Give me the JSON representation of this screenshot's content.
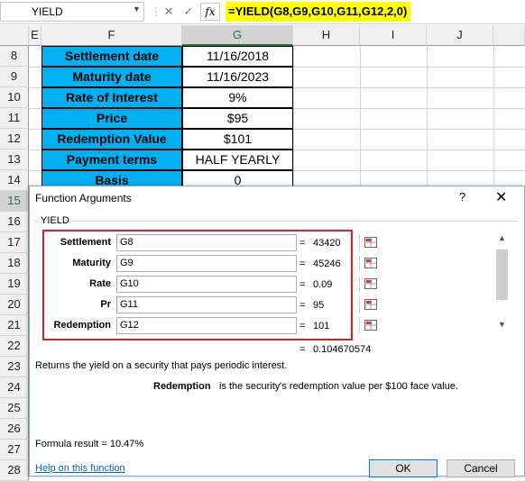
{
  "formula_bar": {
    "name_box": "YIELD",
    "cancel_symbol": "✕",
    "enter_symbol": "✓",
    "fx_label": "fx",
    "formula": "=YIELD(G8,G9,G10,G11,G12,2,0)"
  },
  "columns": [
    "E",
    "F",
    "G",
    "H",
    "I",
    "J"
  ],
  "rows": [
    "8",
    "9",
    "10",
    "11",
    "12",
    "13",
    "14",
    "15",
    "16",
    "17",
    "18",
    "19",
    "20",
    "21",
    "22",
    "23",
    "24",
    "25",
    "26",
    "27",
    "28",
    "29"
  ],
  "table": [
    {
      "label": "Settlement date",
      "value": "11/16/2018"
    },
    {
      "label": "Maturity date",
      "value": "11/16/2023"
    },
    {
      "label": "Rate of Interest",
      "value": "9%"
    },
    {
      "label": "Price",
      "value": "$95"
    },
    {
      "label": "Redemption Value",
      "value": "$101"
    },
    {
      "label": "Payment terms",
      "value": "HALF YEARLY"
    },
    {
      "label": "Basis",
      "value": "0"
    }
  ],
  "dialog": {
    "title": "Function Arguments",
    "help_symbol": "?",
    "close_symbol": "✕",
    "function_name": "YIELD",
    "args": [
      {
        "label": "Settlement",
        "input": "G8",
        "value": "43420"
      },
      {
        "label": "Maturity",
        "input": "G9",
        "value": "45246"
      },
      {
        "label": "Rate",
        "input": "G10",
        "value": "0.09"
      },
      {
        "label": "Pr",
        "input": "G11",
        "value": "95"
      },
      {
        "label": "Redemption",
        "input": "G12",
        "value": "101"
      }
    ],
    "equals": "=",
    "result_value": "0.104670574",
    "description": "Returns the yield on a security that pays periodic interest.",
    "arg_desc_name": "Redemption",
    "arg_desc_text": "is the security's redemption value per $100 face value.",
    "formula_result": "Formula result =   10.47%",
    "help_link": "Help on this function",
    "ok_label": "OK",
    "cancel_label": "Cancel"
  },
  "colors": {
    "label_fill": "#00b0f0",
    "formula_highlight": "#ffff00",
    "highlight_box": "#e21b1b"
  }
}
